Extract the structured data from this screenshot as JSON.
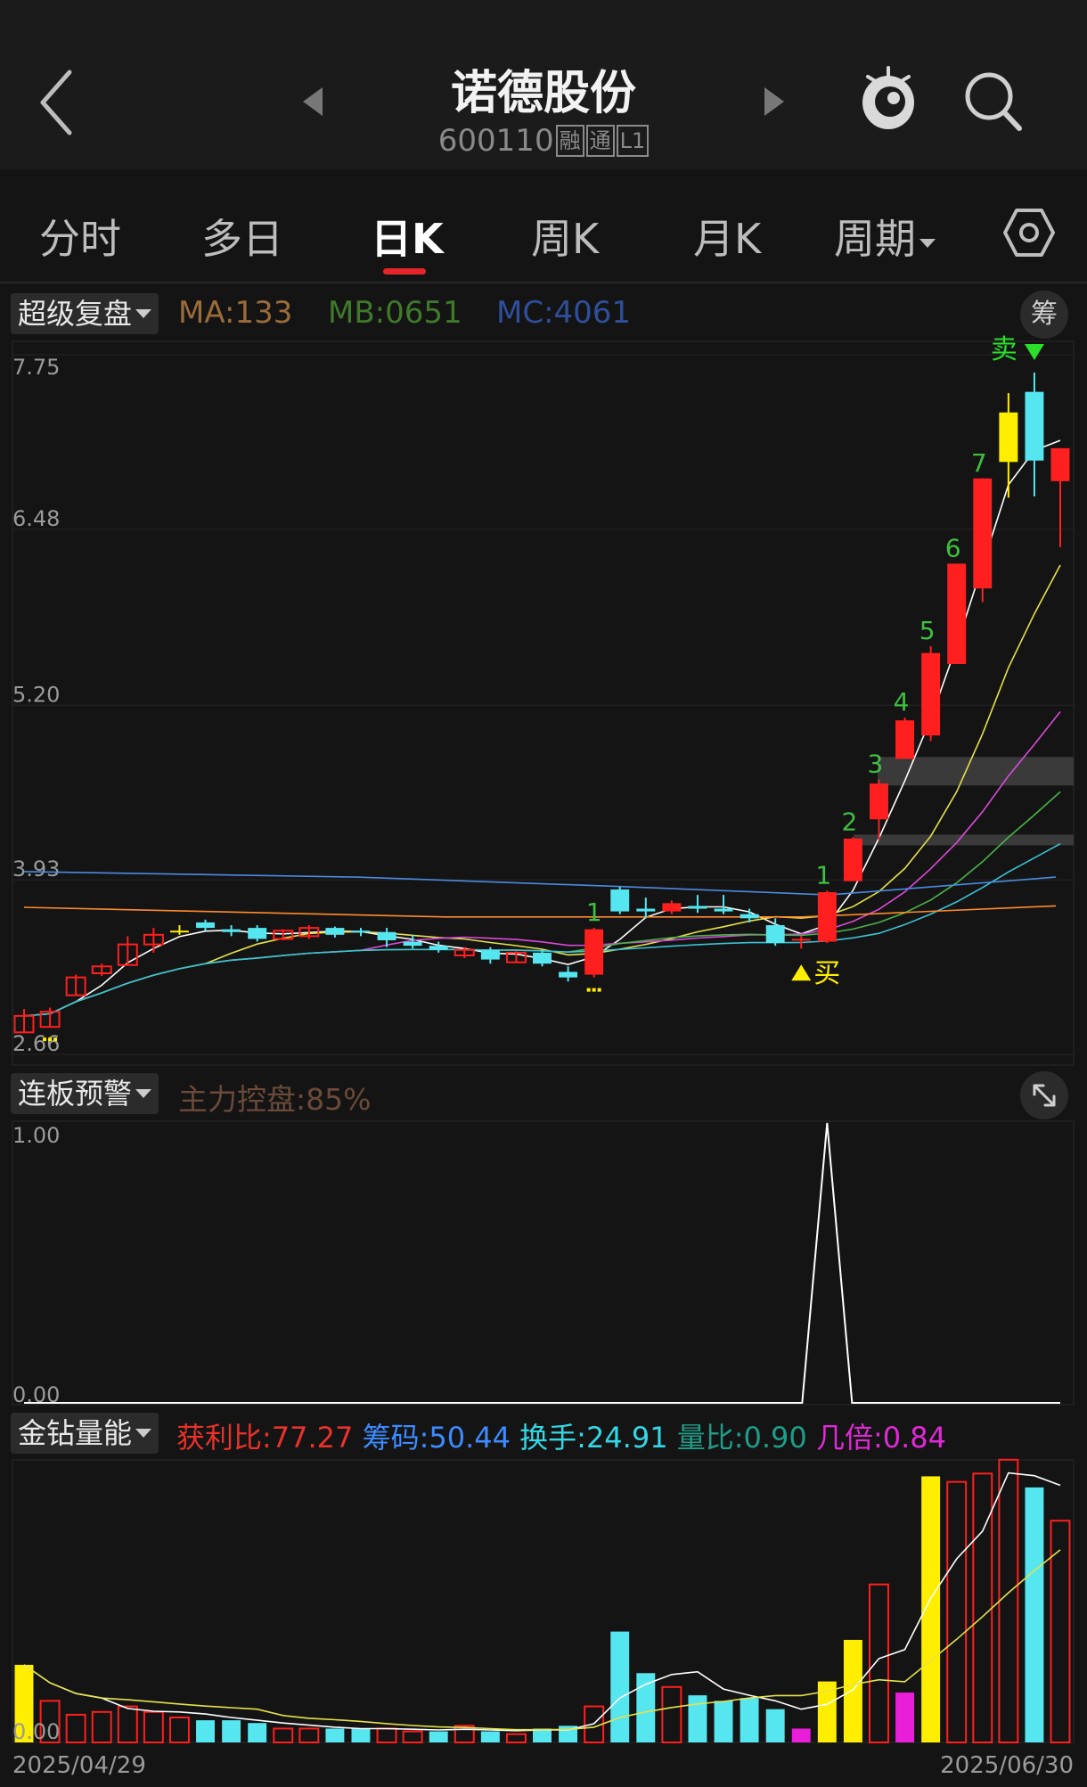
{
  "header": {
    "title": "诺德股份",
    "code": "600110",
    "badges": [
      "融",
      "通",
      "L1"
    ]
  },
  "tabs": [
    {
      "label": "分时",
      "active": false
    },
    {
      "label": "多日",
      "active": false
    },
    {
      "label": "日K",
      "active": true
    },
    {
      "label": "周K",
      "active": false
    },
    {
      "label": "月K",
      "active": false
    },
    {
      "label": "周期",
      "active": false,
      "dropdown": true
    }
  ],
  "main_panel": {
    "indicator": "超级复盘",
    "ma": "MA:133",
    "mb": "MB:0651",
    "mc": "MC:4061",
    "chip_button": "筹",
    "y_ticks": [
      "7.75",
      "6.48",
      "5.20",
      "3.93",
      "2.66"
    ],
    "buy_label": "买",
    "sell_label": "卖",
    "count_labels": [
      "1",
      "1",
      "2",
      "3",
      "4",
      "5",
      "6",
      "7"
    ]
  },
  "board_panel": {
    "indicator": "连板预警",
    "main_control": "主力控盘:85%",
    "y_ticks": [
      "1.00",
      "0.00"
    ]
  },
  "volume_panel": {
    "indicator": "金钻量能",
    "stats": [
      {
        "text": "获利比:77.27",
        "color": "#e8322a"
      },
      {
        "text": "筹码:50.44",
        "color": "#3d8bff"
      },
      {
        "text": "换手:24.91",
        "color": "#33d8e6"
      },
      {
        "text": "量比:0.90",
        "color": "#1f9d88"
      },
      {
        "text": "几倍:0.84",
        "color": "#e02ad8"
      }
    ],
    "y_tick": "0.00",
    "start_date": "2025/04/29",
    "end_date": "2025/06/30"
  },
  "colors": {
    "up": "#ff1f1f",
    "down": "#55e6f0",
    "flat": "#ffee00",
    "ma_label": "#9c6b3a",
    "mb_label": "#3f7a2a",
    "mc_label": "#2f4f9c"
  },
  "chart_data": {
    "type": "candlestick",
    "y_range": [
      2.66,
      7.75
    ],
    "dates_start": "2025/04/29",
    "dates_end": "2025/06/30",
    "candles": [
      {
        "o": 2.82,
        "h": 2.99,
        "l": 2.82,
        "c": 2.94,
        "dir": "up"
      },
      {
        "o": 2.86,
        "h": 3.0,
        "l": 2.86,
        "c": 2.97,
        "dir": "up"
      },
      {
        "o": 3.09,
        "h": 3.24,
        "l": 3.09,
        "c": 3.22,
        "dir": "up"
      },
      {
        "o": 3.25,
        "h": 3.32,
        "l": 3.23,
        "c": 3.3,
        "dir": "up"
      },
      {
        "o": 3.31,
        "h": 3.52,
        "l": 3.31,
        "c": 3.46,
        "dir": "up"
      },
      {
        "o": 3.46,
        "h": 3.58,
        "l": 3.4,
        "c": 3.53,
        "dir": "up"
      },
      {
        "o": 3.55,
        "h": 3.6,
        "l": 3.53,
        "c": 3.56,
        "dir": "flat"
      },
      {
        "o": 3.62,
        "h": 3.64,
        "l": 3.56,
        "c": 3.58,
        "dir": "down"
      },
      {
        "o": 3.57,
        "h": 3.6,
        "l": 3.52,
        "c": 3.55,
        "dir": "down"
      },
      {
        "o": 3.58,
        "h": 3.6,
        "l": 3.48,
        "c": 3.5,
        "dir": "down"
      },
      {
        "o": 3.5,
        "h": 3.57,
        "l": 3.49,
        "c": 3.56,
        "dir": "up"
      },
      {
        "o": 3.52,
        "h": 3.6,
        "l": 3.5,
        "c": 3.58,
        "dir": "up"
      },
      {
        "o": 3.58,
        "h": 3.59,
        "l": 3.51,
        "c": 3.53,
        "dir": "down"
      },
      {
        "o": 3.56,
        "h": 3.58,
        "l": 3.52,
        "c": 3.55,
        "dir": "down"
      },
      {
        "o": 3.55,
        "h": 3.58,
        "l": 3.44,
        "c": 3.49,
        "dir": "down"
      },
      {
        "o": 3.48,
        "h": 3.53,
        "l": 3.43,
        "c": 3.45,
        "dir": "down"
      },
      {
        "o": 3.45,
        "h": 3.48,
        "l": 3.4,
        "c": 3.42,
        "dir": "down"
      },
      {
        "o": 3.38,
        "h": 3.44,
        "l": 3.36,
        "c": 3.42,
        "dir": "up"
      },
      {
        "o": 3.42,
        "h": 3.44,
        "l": 3.32,
        "c": 3.35,
        "dir": "down"
      },
      {
        "o": 3.33,
        "h": 3.41,
        "l": 3.33,
        "c": 3.4,
        "dir": "up"
      },
      {
        "o": 3.4,
        "h": 3.42,
        "l": 3.3,
        "c": 3.32,
        "dir": "down"
      },
      {
        "o": 3.26,
        "h": 3.3,
        "l": 3.19,
        "c": 3.22,
        "dir": "down"
      },
      {
        "o": 3.24,
        "h": 3.58,
        "l": 3.22,
        "c": 3.57,
        "dir": "up"
      },
      {
        "o": 3.86,
        "h": 3.88,
        "l": 3.68,
        "c": 3.7,
        "dir": "down"
      },
      {
        "o": 3.72,
        "h": 3.8,
        "l": 3.65,
        "c": 3.7,
        "dir": "down"
      },
      {
        "o": 3.7,
        "h": 3.78,
        "l": 3.68,
        "c": 3.76,
        "dir": "up"
      },
      {
        "o": 3.72,
        "h": 3.82,
        "l": 3.69,
        "c": 3.74,
        "dir": "down"
      },
      {
        "o": 3.72,
        "h": 3.82,
        "l": 3.68,
        "c": 3.7,
        "dir": "down"
      },
      {
        "o": 3.68,
        "h": 3.72,
        "l": 3.62,
        "c": 3.65,
        "dir": "down"
      },
      {
        "o": 3.6,
        "h": 3.65,
        "l": 3.45,
        "c": 3.47,
        "dir": "down"
      },
      {
        "o": 3.5,
        "h": 3.52,
        "l": 3.43,
        "c": 3.49,
        "dir": "up"
      },
      {
        "o": 3.48,
        "h": 3.85,
        "l": 3.47,
        "c": 3.84,
        "dir": "up"
      },
      {
        "o": 3.92,
        "h": 4.24,
        "l": 3.92,
        "c": 4.23,
        "dir": "up"
      },
      {
        "o": 4.37,
        "h": 4.66,
        "l": 4.22,
        "c": 4.63,
        "dir": "up"
      },
      {
        "o": 4.81,
        "h": 5.11,
        "l": 4.81,
        "c": 5.09,
        "dir": "up"
      },
      {
        "o": 4.98,
        "h": 5.63,
        "l": 4.94,
        "c": 5.58,
        "dir": "up"
      },
      {
        "o": 5.5,
        "h": 6.23,
        "l": 5.5,
        "c": 6.23,
        "dir": "up"
      },
      {
        "o": 6.05,
        "h": 6.85,
        "l": 5.95,
        "c": 6.85,
        "dir": "up"
      },
      {
        "o": 6.97,
        "h": 7.47,
        "l": 6.71,
        "c": 7.33,
        "dir": "flat"
      },
      {
        "o": 7.48,
        "h": 7.62,
        "l": 6.72,
        "c": 6.98,
        "dir": "down"
      },
      {
        "o": 6.83,
        "h": 7.07,
        "l": 6.35,
        "c": 7.07,
        "dir": "up"
      }
    ],
    "board_warning": {
      "x_index": 31,
      "value": 1.0,
      "range": [
        0,
        1
      ]
    },
    "volume": [
      {
        "v": 0.28,
        "color": "flat"
      },
      {
        "v": 0.15,
        "color": "up"
      },
      {
        "v": 0.1,
        "color": "up"
      },
      {
        "v": 0.11,
        "color": "up"
      },
      {
        "v": 0.13,
        "color": "up"
      },
      {
        "v": 0.11,
        "color": "up"
      },
      {
        "v": 0.09,
        "color": "up"
      },
      {
        "v": 0.08,
        "color": "down"
      },
      {
        "v": 0.08,
        "color": "down"
      },
      {
        "v": 0.07,
        "color": "down"
      },
      {
        "v": 0.05,
        "color": "up"
      },
      {
        "v": 0.05,
        "color": "up"
      },
      {
        "v": 0.05,
        "color": "down"
      },
      {
        "v": 0.05,
        "color": "down"
      },
      {
        "v": 0.05,
        "color": "up"
      },
      {
        "v": 0.04,
        "color": "up"
      },
      {
        "v": 0.04,
        "color": "down"
      },
      {
        "v": 0.06,
        "color": "up"
      },
      {
        "v": 0.04,
        "color": "down"
      },
      {
        "v": 0.03,
        "color": "up"
      },
      {
        "v": 0.05,
        "color": "down"
      },
      {
        "v": 0.06,
        "color": "down"
      },
      {
        "v": 0.13,
        "color": "up"
      },
      {
        "v": 0.4,
        "color": "down"
      },
      {
        "v": 0.25,
        "color": "down"
      },
      {
        "v": 0.2,
        "color": "up"
      },
      {
        "v": 0.17,
        "color": "down"
      },
      {
        "v": 0.15,
        "color": "down"
      },
      {
        "v": 0.16,
        "color": "down"
      },
      {
        "v": 0.12,
        "color": "down"
      },
      {
        "v": 0.05,
        "color": "magenta"
      },
      {
        "v": 0.22,
        "color": "flat"
      },
      {
        "v": 0.37,
        "color": "flat"
      },
      {
        "v": 0.57,
        "color": "up"
      },
      {
        "v": 0.18,
        "color": "magenta"
      },
      {
        "v": 0.96,
        "color": "flat"
      },
      {
        "v": 0.94,
        "color": "up"
      },
      {
        "v": 0.97,
        "color": "up"
      },
      {
        "v": 1.02,
        "color": "up"
      },
      {
        "v": 0.92,
        "color": "down"
      },
      {
        "v": 0.8,
        "color": "up"
      }
    ]
  }
}
